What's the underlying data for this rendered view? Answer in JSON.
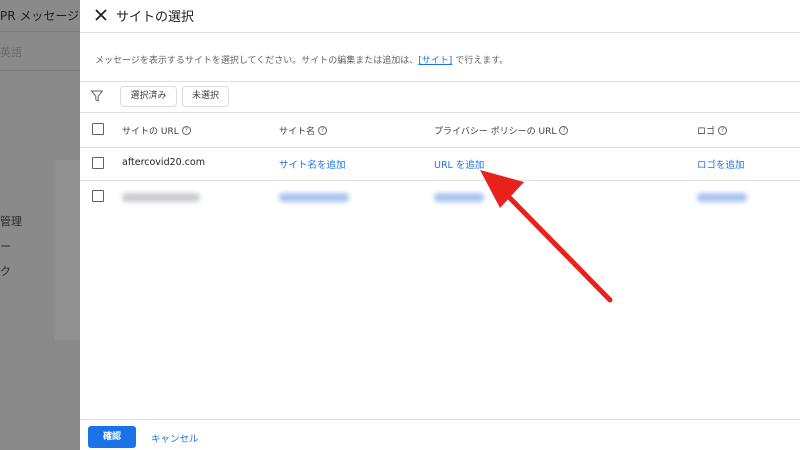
{
  "background": {
    "header_title": "PR メッセージ",
    "sub_label": "英語",
    "items": [
      "管理",
      "ー",
      "ク"
    ]
  },
  "dialog": {
    "title": "サイトの選択",
    "description_prefix": "メッセージを表示するサイトを選択してください。サイトの編集または追加は、",
    "description_link": "[サイト]",
    "description_suffix": " で行えます。",
    "filter_chips": [
      "選択済み",
      "未選択"
    ],
    "columns": [
      "サイトの URL",
      "サイト名",
      "プライバシー ポリシーの URL",
      "ロゴ"
    ],
    "rows": [
      {
        "url": "aftercovid20.com",
        "site_name": "サイト名を追加",
        "privacy_url": "URL を追加",
        "logo": "ロゴを追加",
        "blurred": false
      },
      {
        "url": "",
        "site_name": "",
        "privacy_url": "",
        "logo": "",
        "blurred": true
      }
    ],
    "confirm_label": "確認",
    "cancel_label": "キャンセル"
  },
  "colors": {
    "accent": "#1a73e8",
    "annotation_arrow": "#e8211d"
  },
  "icons": {
    "close": "close-icon",
    "filter": "filter-icon",
    "help": "help-icon"
  }
}
